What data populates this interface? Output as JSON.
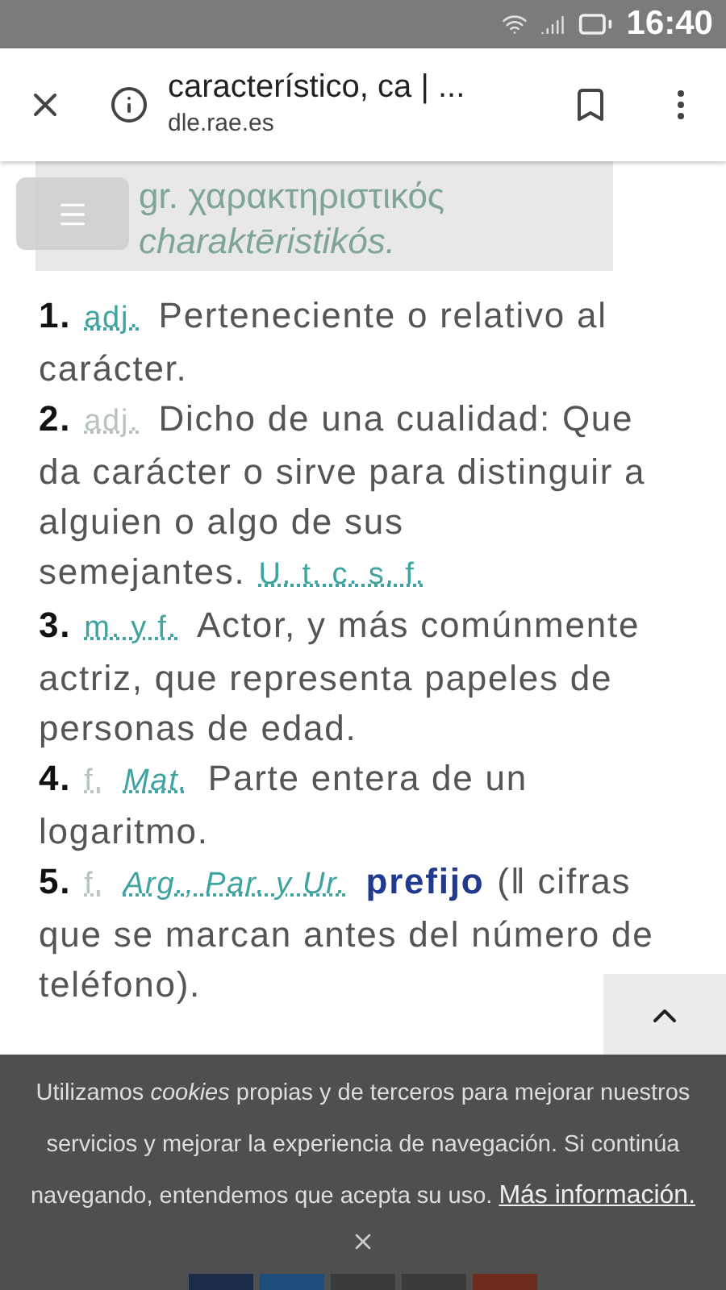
{
  "status_bar": {
    "time": "16:40"
  },
  "browser": {
    "title": "característico, ca | ...",
    "url": "dle.rae.es"
  },
  "etymology": {
    "lines": [
      "gr. χαρακτηριστικός",
      "charaktēristikós."
    ]
  },
  "definitions": [
    {
      "number": "1.",
      "parts": [
        {
          "kind": "abbr",
          "text": "adj."
        },
        {
          "kind": "text",
          "text": "Perteneciente o relativo al carácter."
        }
      ]
    },
    {
      "number": "2.",
      "parts": [
        {
          "kind": "abbr_faded",
          "text": "adj."
        },
        {
          "kind": "text",
          "text": "Dicho de una cualidad: Que da carácter o sirve para distinguir a alguien o algo de sus semejantes."
        },
        {
          "kind": "abbr",
          "text": "U. t. c. s. f."
        }
      ]
    },
    {
      "number": "3.",
      "parts": [
        {
          "kind": "abbr",
          "text": "m. y f."
        },
        {
          "kind": "text",
          "text": "Actor, y más comúnmente actriz, que representa papeles de personas de edad."
        }
      ]
    },
    {
      "number": "4.",
      "parts": [
        {
          "kind": "abbr_faded",
          "text": "f."
        },
        {
          "kind": "abbr_italic",
          "text": "Mat."
        },
        {
          "kind": "text",
          "text": "Parte entera de un logaritmo."
        }
      ]
    },
    {
      "number": "5.",
      "parts": [
        {
          "kind": "abbr_faded",
          "text": "f."
        },
        {
          "kind": "abbr_italic",
          "text": "Arg., Par. y Ur."
        },
        {
          "kind": "link",
          "text": "prefijo"
        },
        {
          "kind": "text",
          "text": "(‖ cifras que se marcan antes del número de teléfono)."
        }
      ]
    }
  ],
  "cookie_banner": {
    "message": "Utilizamos *cookies* propias y de terceros para mejorar nuestros servicios y mejorar la experiencia de navegación. Si continúa navegando, entendemos que acepta su uso.",
    "link": "Más información."
  },
  "share_buttons": [
    {
      "color": "#1b2c4a"
    },
    {
      "color": "#1e4f7c"
    },
    {
      "color": "#3a3a3a"
    },
    {
      "color": "#3a3a3a"
    },
    {
      "color": "#6e2c1c"
    }
  ]
}
